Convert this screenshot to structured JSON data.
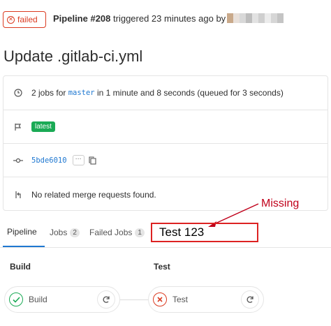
{
  "header": {
    "status": "failed",
    "pipeline_label": "Pipeline #208",
    "triggered_text": "triggered 23 minutes ago by"
  },
  "title": "Update .gitlab-ci.yml",
  "info": {
    "jobs_prefix": "2 jobs for",
    "branch": "master",
    "jobs_suffix": "in 1 minute and 8 seconds (queued for 3 seconds)",
    "tag": "latest",
    "commit_sha": "5bde6010",
    "dots": "···",
    "merge_requests": "No related merge requests found."
  },
  "tabs": [
    {
      "label": "Pipeline"
    },
    {
      "label": "Jobs",
      "count": "2"
    },
    {
      "label": "Failed Jobs",
      "count": "1"
    }
  ],
  "annotation": {
    "missing": "Missing",
    "test_tab": "Test 123"
  },
  "stages": [
    {
      "title": "Build",
      "job": "Build",
      "status": "success"
    },
    {
      "title": "Test",
      "job": "Test",
      "status": "failed"
    }
  ],
  "colors": {
    "failed": "#db3b21",
    "success": "#1aaa55",
    "link": "#1f78d1",
    "annotation": "#c0001a"
  }
}
